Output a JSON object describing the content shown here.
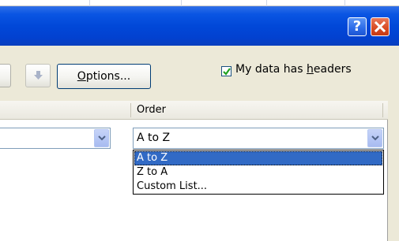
{
  "titlebar": {
    "help_label": "?",
    "close_icon": "close-icon"
  },
  "toolbar": {
    "options_label_underlined": "O",
    "options_label_rest": "ptions...",
    "move_down_icon": "arrow-down-icon"
  },
  "headers_option": {
    "checked": true,
    "label_before": "My data has ",
    "label_underlined": "h",
    "label_after": "eaders"
  },
  "grid": {
    "order_header": "Order",
    "order_value": "A to Z"
  },
  "dropdown": {
    "items": [
      "A to Z",
      "Z to A",
      "Custom List..."
    ],
    "selected_index": 0
  },
  "colors": {
    "titlebar": "#0148d8",
    "selection": "#316ac5",
    "close_button": "#d84a23"
  }
}
